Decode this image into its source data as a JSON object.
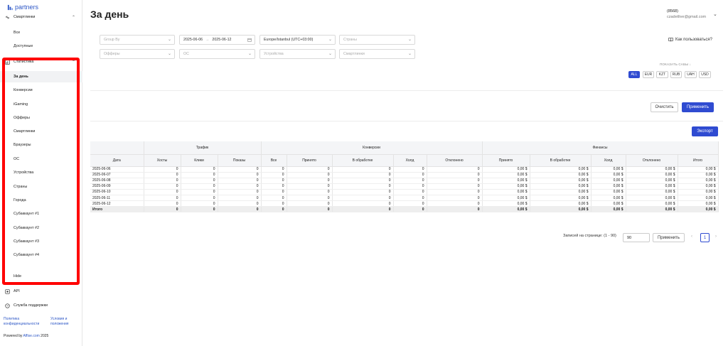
{
  "brand": {
    "logo_text": "partners"
  },
  "sidebar": {
    "items": [
      {
        "label": "Смартлинки",
        "icon": "link-icon",
        "chevron": "⌃"
      },
      {
        "label": "Все"
      },
      {
        "label": "Доступные"
      },
      {
        "label": "Статистика",
        "icon": "chart-icon",
        "chevron": "⌃"
      },
      {
        "label": "За день"
      },
      {
        "label": "Конверсии"
      },
      {
        "label": "iGaming"
      },
      {
        "label": "Офферы"
      },
      {
        "label": "Смартлинки"
      },
      {
        "label": "Браузеры"
      },
      {
        "label": "ОС"
      },
      {
        "label": "Устройства"
      },
      {
        "label": "Страны"
      },
      {
        "label": "Города"
      },
      {
        "label": "Субаккаунт #1"
      },
      {
        "label": "Субаккаунт #2"
      },
      {
        "label": "Субаккаунт #3"
      },
      {
        "label": "Субаккаунт #4"
      },
      {
        "label": "Hide",
        "icon": "eye-off-icon"
      },
      {
        "label": "API",
        "icon": "api-icon"
      },
      {
        "label": "Служба поддержки",
        "icon": "help-icon"
      }
    ],
    "footer": {
      "privacy": [
        "Политика",
        "конфиденциальности"
      ],
      "terms": [
        "Условия и",
        "положения"
      ],
      "powered_prefix": "Powered by ",
      "powered_link": "Affise.com",
      "powered_suffix": " 2025"
    }
  },
  "header": {
    "title": "За день",
    "user_id": "(8568)",
    "user_email": "czadetlive@gmail.com"
  },
  "filters": {
    "group_by": "Group By",
    "date_from": "2025-06-06",
    "date_arrow": "→",
    "date_to": "2025-06-12",
    "timezone": "Europe/Istanbul (UTC+03:00)",
    "countries": "Страны",
    "offers": "Офферы",
    "os": "ОС",
    "devices": "Устройства",
    "smartlinks": "Смартлинки",
    "howto": "Как пользоваться?",
    "show_cases": "ПОКАЗАТЬ САБЫ",
    "currencies": [
      "ALL",
      "EUR",
      "KZT",
      "RUB",
      "UAH",
      "USD"
    ],
    "active_currency": "ALL",
    "clear": "Очистить",
    "apply": "Применить",
    "export": "Экспорт"
  },
  "table": {
    "groups": [
      "Трафик",
      "Конверсии",
      "Финансы"
    ],
    "columns": [
      "Дата",
      "Хосты",
      "Клики",
      "Показы",
      "Все",
      "Принято",
      "В обработке",
      "Холд",
      "Отклонено",
      "Принято",
      "В обработке",
      "Холд",
      "Отклонено",
      "Итого"
    ],
    "rows": [
      [
        "2025-06-06",
        "0",
        "0",
        "0",
        "0",
        "0",
        "0",
        "0",
        "0",
        "0,00 $",
        "0,00 $",
        "0,00 $",
        "0,00 $",
        "0,00 $"
      ],
      [
        "2025-06-07",
        "0",
        "0",
        "0",
        "0",
        "0",
        "0",
        "0",
        "0",
        "0,00 $",
        "0,00 $",
        "0,00 $",
        "0,00 $",
        "0,00 $"
      ],
      [
        "2025-06-08",
        "0",
        "0",
        "0",
        "0",
        "0",
        "0",
        "0",
        "0",
        "0,00 $",
        "0,00 $",
        "0,00 $",
        "0,00 $",
        "0,00 $"
      ],
      [
        "2025-06-09",
        "0",
        "0",
        "0",
        "0",
        "0",
        "0",
        "0",
        "0",
        "0,00 $",
        "0,00 $",
        "0,00 $",
        "0,00 $",
        "0,00 $"
      ],
      [
        "2025-06-10",
        "0",
        "0",
        "0",
        "0",
        "0",
        "0",
        "0",
        "0",
        "0,00 $",
        "0,00 $",
        "0,00 $",
        "0,00 $",
        "0,00 $"
      ],
      [
        "2025-06-11",
        "0",
        "0",
        "0",
        "0",
        "0",
        "0",
        "0",
        "0",
        "0,00 $",
        "0,00 $",
        "0,00 $",
        "0,00 $",
        "0,00 $"
      ],
      [
        "2025-06-12",
        "0",
        "0",
        "0",
        "0",
        "0",
        "0",
        "0",
        "0",
        "0,00 $",
        "0,00 $",
        "0,00 $",
        "0,00 $",
        "0,00 $"
      ],
      [
        "Итого",
        "0",
        "0",
        "0",
        "0",
        "0",
        "0",
        "0",
        "0",
        "0,00 $",
        "0,00 $",
        "0,00 $",
        "0,00 $",
        "0,00 $"
      ]
    ]
  },
  "pagination": {
    "label": "Записей на странице: (1 - 90)",
    "per_page": "90",
    "apply": "Применить",
    "current_page": "1",
    "prev": "‹",
    "next": "›"
  },
  "colors": {
    "accent": "#2f4bd1",
    "highlight": "#ff0000",
    "link": "#2c56c6"
  }
}
